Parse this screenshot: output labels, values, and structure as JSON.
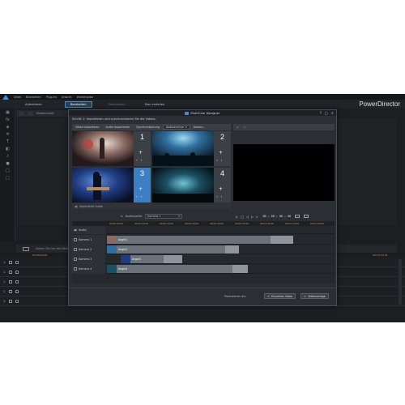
{
  "menubar": {
    "items": [
      "Datei",
      "Bearbeiten",
      "Plug-Ins",
      "Ansicht",
      "Wiedergabe"
    ]
  },
  "modebar": {
    "tabs": [
      {
        "label": "Aufnehmen",
        "state": "normal"
      },
      {
        "label": "Bearbeiten",
        "state": "active"
      },
      {
        "label": "Produzieren",
        "state": "muted"
      },
      {
        "label": "Disc erstellen",
        "state": "normal"
      }
    ],
    "brand": "PowerDirector"
  },
  "library": {
    "header_label": "Medieninhalt"
  },
  "backbar": {
    "hint": "Ziehen Sie hier die Medien..."
  },
  "back_timeline": {
    "ruler": [
      "00;00;00;00",
      "00;03;20;00",
      "00;06;40;03",
      "00;46;36;14",
      "00;50;00;17",
      "00;53;20;18"
    ],
    "tracks": [
      "1.",
      "1.",
      "2.",
      "2.",
      "3."
    ]
  },
  "dialog": {
    "title": "MultiCam Designer",
    "instruction": "Schritt 1: Importieren und synchronisieren Sie die Videos.",
    "tabs": [
      "Video importieren",
      "Audio importieren",
      "Synchronisierung"
    ],
    "sync_select": "Audioanalyse",
    "more_label": "Anwen...",
    "cameras": [
      {
        "number": "1",
        "selected": false
      },
      {
        "number": "2",
        "selected": false
      },
      {
        "number": "3",
        "selected": true
      },
      {
        "number": "4",
        "selected": false
      }
    ],
    "audio_row": "Importierte Audio",
    "audio_source_label": "Audioquelle:",
    "audio_source_value": "Kamera 1",
    "preview_timecode": "00 ; 00 ; 00 ; 00",
    "timeline": {
      "ruler": [
        "00;00;00;00",
        "00;00;10;00",
        "00;00;20;00",
        "00;00;30;00",
        "00;00;40;00",
        "00;00;50;00",
        "00;01;00;00",
        "00;01;10;00",
        "00;01;20;00"
      ],
      "audio_label": "Audio",
      "rows": [
        {
          "label": "Kamera 1",
          "clip": "Angle1",
          "start_frac": 0.0,
          "end_frac": 0.82,
          "fade_frac": 0.72
        },
        {
          "label": "Kamera 2",
          "clip": "Angle2",
          "start_frac": 0.0,
          "end_frac": 0.58,
          "fade_frac": 0.52
        },
        {
          "label": "Kamera 3",
          "clip": "Angle3",
          "start_frac": 0.06,
          "end_frac": 0.33,
          "fade_frac": 0.25
        },
        {
          "label": "Kamera 4",
          "clip": "Angle4",
          "start_frac": 0.0,
          "end_frac": 0.62,
          "fade_frac": 0.55
        }
      ]
    },
    "footer": {
      "label": "Produzieren als:",
      "btn_single": "Einzelnes Video",
      "btn_project": "Videovorlage"
    }
  },
  "colors": {
    "accent": "#3d7fc4",
    "timecode": "#c89a3c",
    "clip": "#6c7279"
  }
}
